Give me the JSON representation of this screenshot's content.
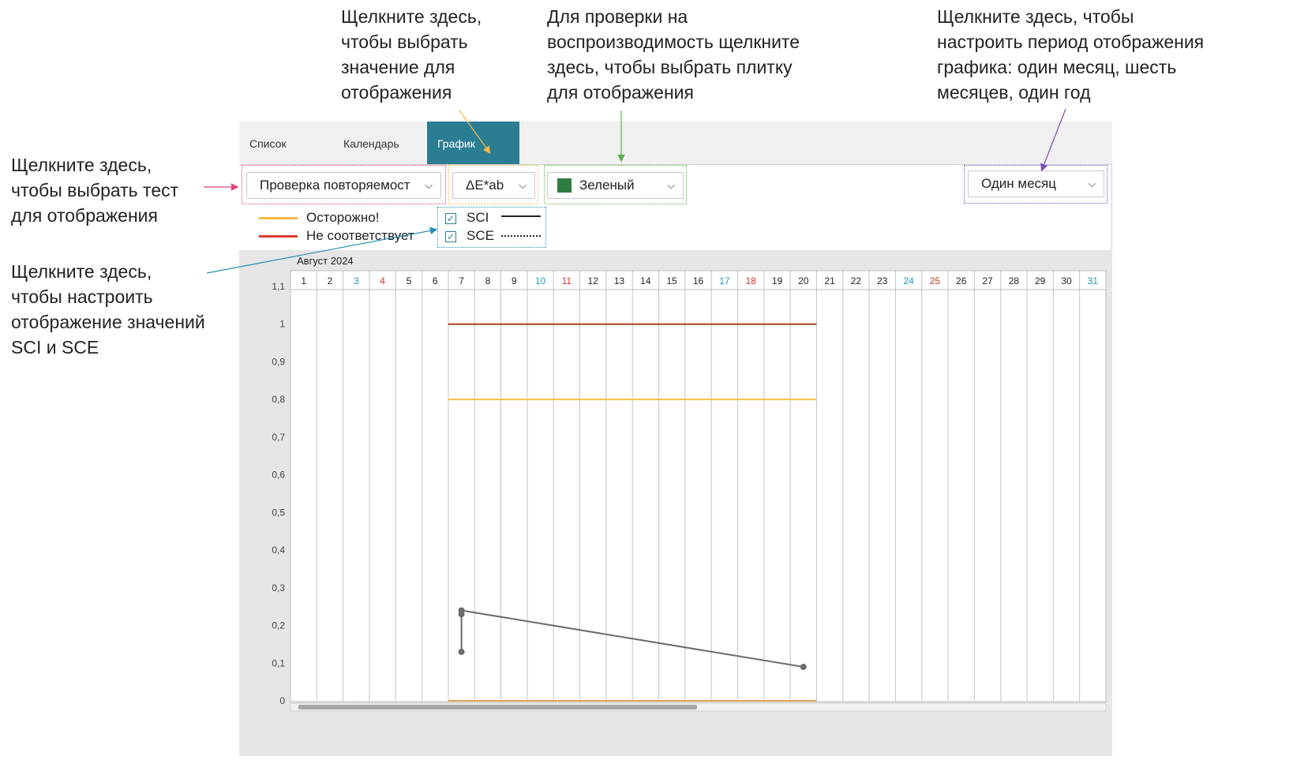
{
  "callouts": {
    "select_value": "Щелкните здесь,\nчтобы выбрать\nзначение для\nотображения",
    "select_tile": "Для проверки на\nвоспроизводимость щелкните\nздесь, чтобы выбрать плитку\nдля отображения",
    "select_period": "Щелкните здесь, чтобы\nнастроить период отображения\nграфика: один месяц, шесть\nмесяцев, один год",
    "select_test": "Щелкните здесь,\nчтобы выбрать тест\nдля отображения",
    "sci_sce": "Щелкните здесь,\nчтобы настроить\nотображение значений\nSCI и SCE"
  },
  "tabs": [
    {
      "label": "Список",
      "active": false
    },
    {
      "label": "Календарь",
      "active": false
    },
    {
      "label": "График",
      "active": true
    }
  ],
  "toolbar": {
    "test_select": "Проверка повторяемост",
    "value_select": "ΔE*ab",
    "tile_select": "Зеленый",
    "tile_color": "#2e7d3c",
    "period_select": "Один месяц"
  },
  "legend": {
    "caution": "Осторожно!",
    "caution_color": "#f5b942",
    "fail": "Не соответствует",
    "fail_color": "#e03a2e",
    "sci": "SCI",
    "sci_checked": true,
    "sce": "SCE",
    "sce_checked": true
  },
  "icons": {
    "chevron": "chevron-down-icon",
    "check": "checkmark-icon"
  },
  "chart_data": {
    "type": "line",
    "month_label": "Август 2024",
    "days": [
      "1",
      "2",
      "3",
      "4",
      "5",
      "6",
      "7",
      "8",
      "9",
      "10",
      "11",
      "12",
      "13",
      "14",
      "15",
      "16",
      "17",
      "18",
      "19",
      "20",
      "21",
      "22",
      "23",
      "24",
      "25",
      "26",
      "27",
      "28",
      "29",
      "30",
      "31"
    ],
    "saturdays": [
      "3",
      "10",
      "17",
      "24",
      "31"
    ],
    "sundays": [
      "4",
      "11",
      "18",
      "25"
    ],
    "weekday_color": "#222222",
    "saturday_color": "#1e9ac0",
    "sunday_color": "#d0342c",
    "yticks": [
      "1,1",
      "1",
      "0,9",
      "0,8",
      "0,7",
      "0,6",
      "0,5",
      "0,4",
      "0,3",
      "0,2",
      "0,1",
      "0"
    ],
    "ylim": [
      0,
      1.1
    ],
    "thresholds": [
      {
        "value": 1.0,
        "color": "#a0441e",
        "from_day": 7,
        "to_day": 21
      },
      {
        "value": 0.8,
        "color": "#f5c04a",
        "from_day": 7,
        "to_day": 21
      },
      {
        "value": 0.0,
        "color": "#e8a45c",
        "from_day": 7,
        "to_day": 21
      }
    ],
    "series": [
      {
        "x": [
          7,
          7,
          7,
          20
        ],
        "y": [
          0.13,
          0.23,
          0.24,
          0.09
        ],
        "color": "#6b6b6b"
      }
    ]
  }
}
